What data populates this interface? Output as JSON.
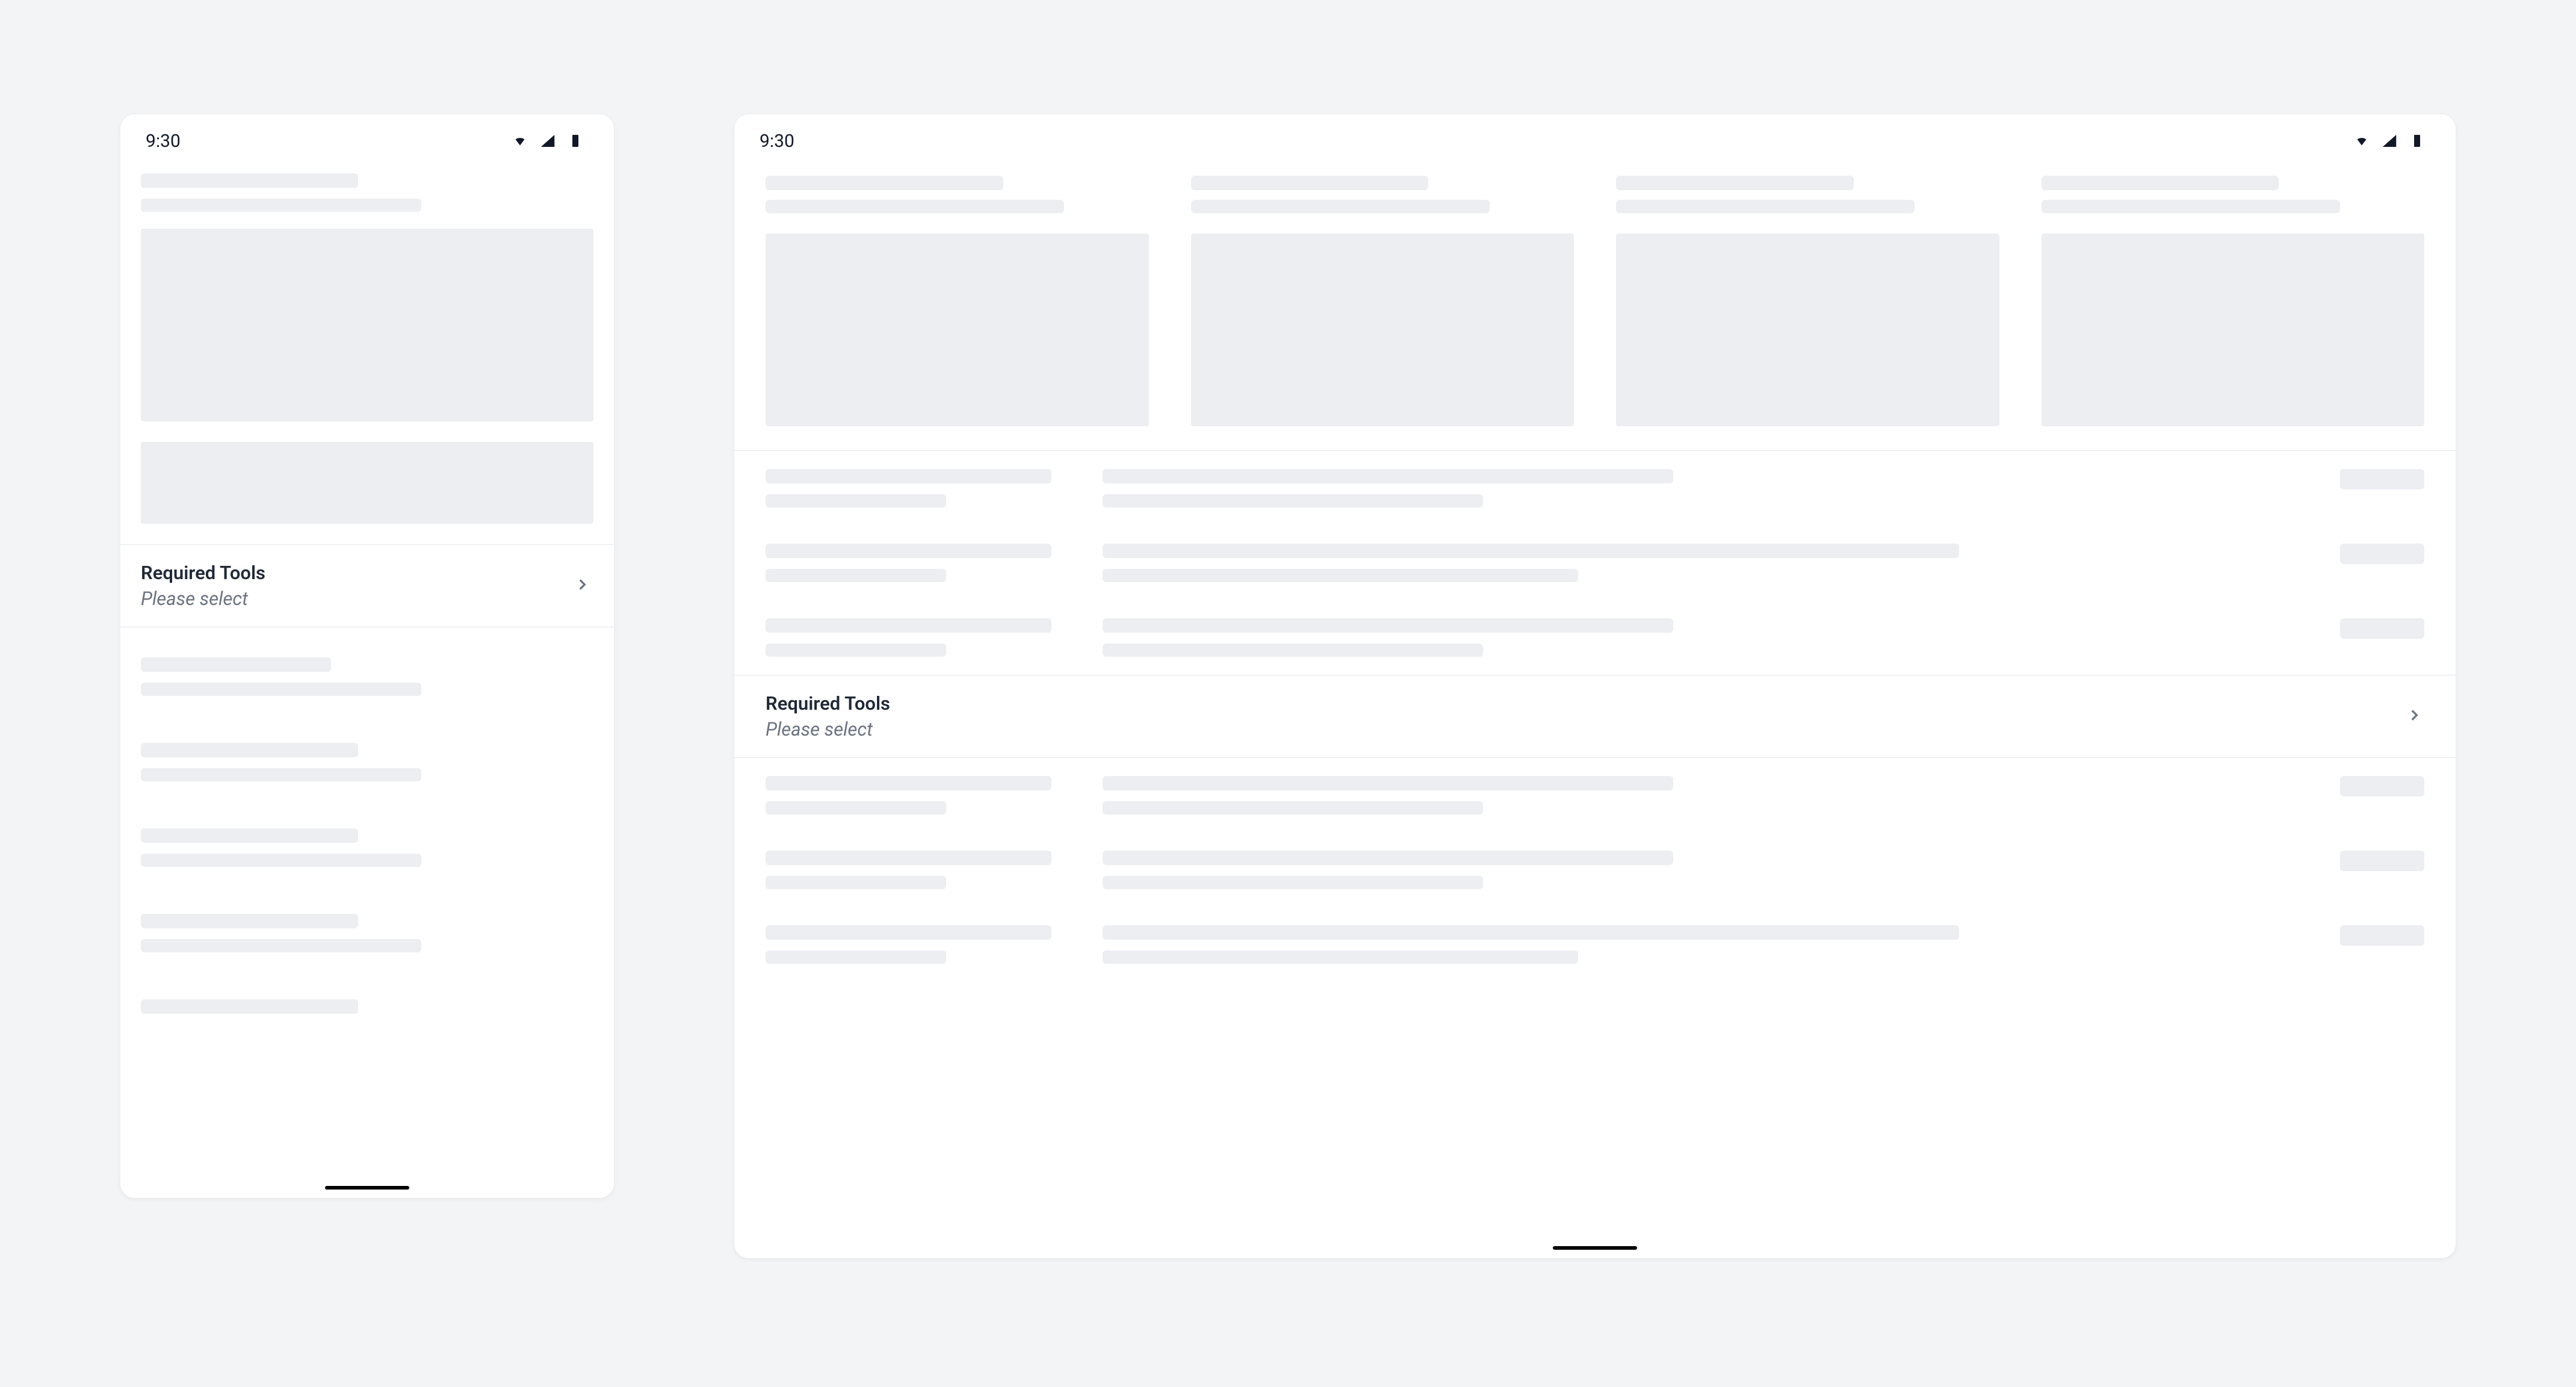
{
  "status_bar": {
    "time": "9:30",
    "icons": [
      "wifi-icon",
      "cellular-icon",
      "battery-icon"
    ]
  },
  "phone": {
    "field": {
      "label": "Required Tools",
      "placeholder": "Please select"
    }
  },
  "tablet": {
    "field": {
      "label": "Required Tools",
      "placeholder": "Please select"
    }
  }
}
